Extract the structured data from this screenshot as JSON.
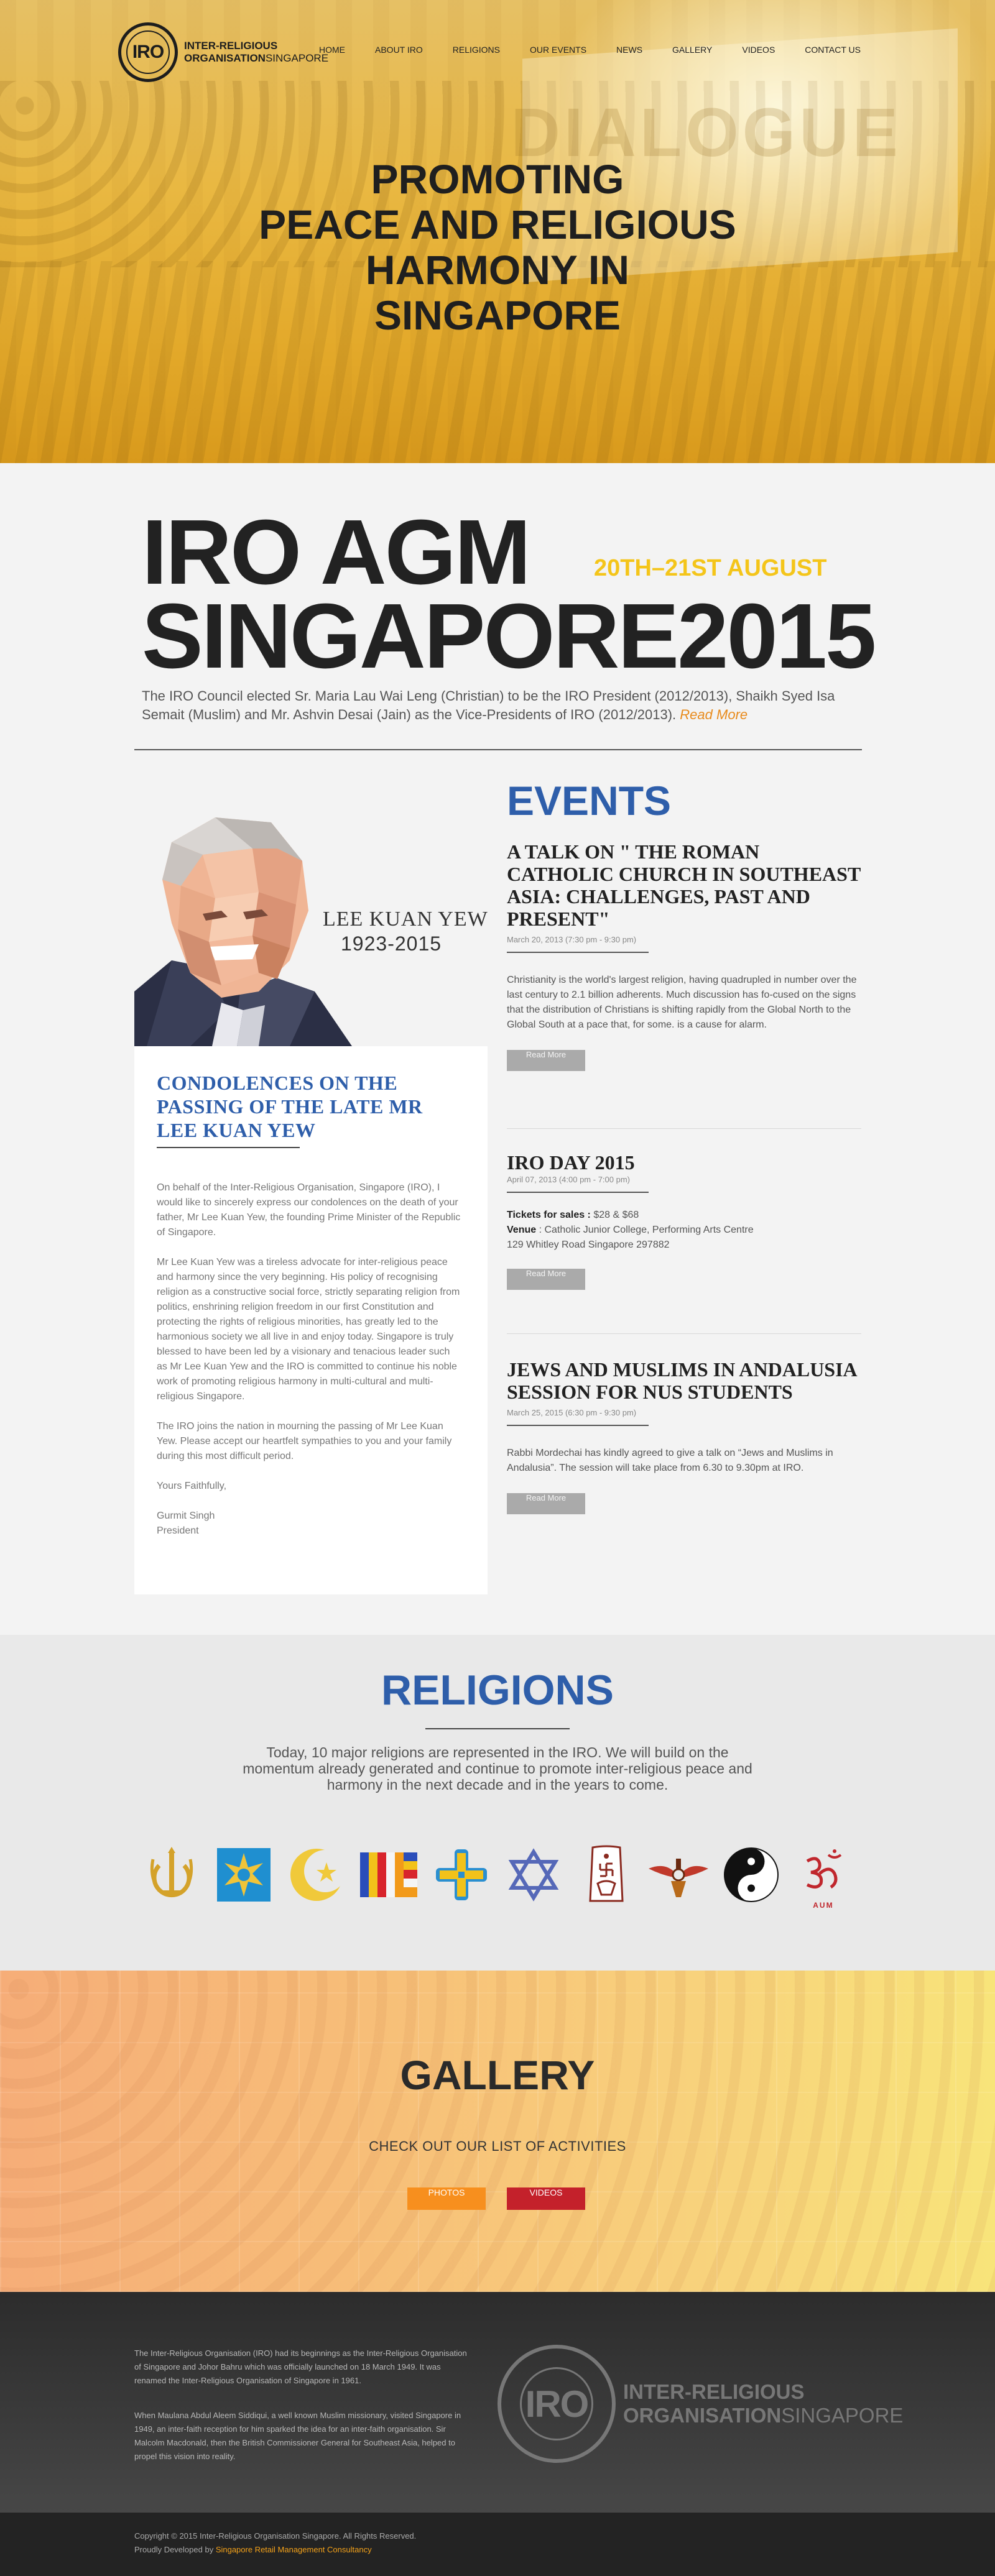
{
  "brand": {
    "logo_mark": "IRO",
    "name_line1": "INTER-RELIGIOUS",
    "name_line2_bold": "ORGANISATION",
    "name_line2_light": "SINGAPORE"
  },
  "nav": {
    "items": [
      "HOME",
      "ABOUT IRO",
      "RELIGIONS",
      "OUR EVENTS",
      "NEWS",
      "GALLERY",
      "VIDEOS",
      "CONTACT US"
    ]
  },
  "hero": {
    "title_lines": [
      "PROMOTING",
      "PEACE AND RELIGIOUS",
      "HARMONY IN",
      "SINGAPORE"
    ],
    "background_word": "DIALOGUE"
  },
  "agm": {
    "line1": "IRO AGM",
    "line2": "SINGAPORE2015",
    "date": "20TH–21ST AUGUST",
    "description": "The IRO Council elected Sr. Maria Lau Wai Leng (Christian) to be the IRO President (2012/2013), Shaikh Syed Isa Semait (Muslim) and Mr. Ashvin Desai (Jain) as the Vice-Presidents of IRO (2012/2013). ",
    "read_more": "Read More"
  },
  "tribute": {
    "name": "LEE KUAN YEW",
    "years": "1923-2015",
    "heading": "CONDOLENCES ON THE PASSING OF THE LATE MR LEE KUAN YEW",
    "paragraphs": [
      "On behalf of the Inter-Religious Organisation, Singapore (IRO), I would like to sincerely express our condolences on the death of your father, Mr Lee Kuan Yew, the founding Prime Minister of the Republic of Singapore.",
      "Mr Lee Kuan Yew was a tireless advocate for inter-religious peace and harmony since the very beginning. His policy of recognising religion as a constructive social force, strictly separating religion from politics, enshrining religion freedom in our first Constitution and protecting the rights of religious minorities, has greatly led to the harmonious society we all live in and enjoy today. Singapore is truly blessed to have been led by a visionary and tenacious leader such as Mr Lee Kuan Yew and the IRO is committed to continue his noble work of promoting religious harmony in multi-cultural and multi-religious Singapore.",
      "The IRO joins the nation in mourning the passing of Mr Lee Kuan Yew. Please accept our heartfelt sympathies to you and your family during this most difficult period.",
      "Yours Faithfully,",
      "Gurmit Singh\nPresident"
    ]
  },
  "events": {
    "heading": "EVENTS",
    "items": [
      {
        "title": "A TALK ON \" THE ROMAN CATHOLIC CHURCH IN SOUTHEAST ASIA: CHALLENGES, PAST AND PRESENT\"",
        "date": "March 20, 2013 (7:30 pm - 9:30 pm)",
        "body": "Christianity is the world's largest religion, having quadrupled in number over the last century to 2.1 billion adherents. Much discussion has fo-cused on the signs that the distribution of Christians is shifting rapidly from the Global North to the Global South at a pace that, for some. is a cause for alarm.",
        "button": "Read More"
      },
      {
        "title": "IRO DAY 2015",
        "date": "April 07, 2013 (4:00 pm - 7:00 pm)",
        "tickets_label": "Tickets for sales :",
        "tickets_value": " $28 & $68",
        "venue_label": "Venue",
        "venue_value": " : Catholic Junior College, Performing Arts Centre",
        "address": "129 Whitley Road Singapore 297882",
        "button": "Read More"
      },
      {
        "title": "JEWS AND MUSLIMS IN ANDALUSIA SESSION FOR NUS STUDENTS",
        "date": "March 25, 2015 (6:30 pm - 9:30 pm)",
        "body": "Rabbi Mordechai has kindly agreed to give a talk on “Jews and Muslims in Andalusia”. The session will take place from 6.30 to 9.30pm at IRO.",
        "button": "Read More"
      }
    ]
  },
  "religions": {
    "heading": "RELIGIONS",
    "description": "Today, 10 major religions are represented in the IRO. We will build on the momentum already generated and continue to promote inter-religious peace and harmony in the next decade and in the years to come.",
    "symbols": [
      "khanda-icon",
      "bahai-star-icon",
      "crescent-star-icon",
      "buddhist-flag-icon",
      "christian-cross-icon",
      "star-of-david-icon",
      "jain-symbol-icon",
      "zoroastrian-faravahar-icon",
      "yin-yang-icon",
      "om-icon"
    ],
    "om_caption": "AUM"
  },
  "gallery": {
    "heading": "GALLERY",
    "subtitle": "CHECK OUT OUR LIST OF ACTIVITIES",
    "photos_button": "PHOTOS",
    "videos_button": "VIDEOS"
  },
  "footer": {
    "para1": "The Inter-Religious Organisation (IRO) had its beginnings as the Inter-Religious Organisation of Singapore and Johor Bahru which was officially launched on 18 March 1949. It was renamed the Inter-Religious Organisation of Singapore in 1961.",
    "para2": "When Maulana Abdul Aleem Siddiqui, a well known Muslim missionary, visited Singapore in 1949, an inter-faith reception for him sparked the idea for an inter-faith organisation. Sir Malcolm Macdonald, then the British Commissioner General for Southeast Asia, helped to propel this vision into reality.",
    "copyright": "Copyright © 2015 Inter-Religious Organisation Singapore. All Rights Reserved.",
    "developed_prefix": "Proudly Developed by ",
    "developer": "Singapore Retail Management Consultancy"
  },
  "colors": {
    "accent_blue": "#2e5eaa",
    "accent_yellow": "#f4c51a",
    "link_orange": "#e88b1d",
    "photos_orange": "#f78f1e",
    "videos_red": "#c4212b"
  }
}
